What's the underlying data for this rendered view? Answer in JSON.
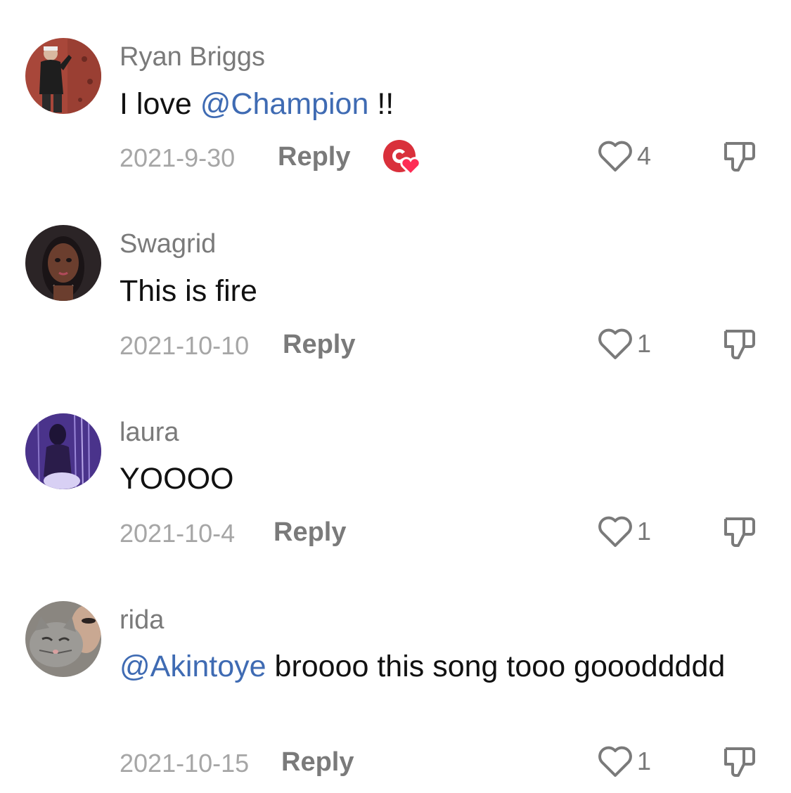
{
  "comments": [
    {
      "username": "Ryan Briggs",
      "text_before": "I love ",
      "mention": "@Champion",
      "text_after": " !!",
      "date": "2021-9-30",
      "reply_label": "Reply",
      "likes": "4",
      "creator_liked": true,
      "avatar_icon": "person-climbing-wall"
    },
    {
      "username": "Swagrid",
      "text": "This is fire",
      "date": "2021-10-10",
      "reply_label": "Reply",
      "likes": "1",
      "avatar_icon": "cartoon-princess"
    },
    {
      "username": "laura",
      "text": "YOOOO",
      "date": "2021-10-4",
      "reply_label": "Reply",
      "likes": "1",
      "avatar_icon": "purple-lit-portrait"
    },
    {
      "username": "rida",
      "mention": "@Akintoye",
      "text_after": " broooo this song tooo goooddddd",
      "date": "2021-10-15",
      "reply_label": "Reply",
      "likes": "1",
      "avatar_icon": "gray-cat"
    }
  ],
  "colors": {
    "mention": "#3f6bb3",
    "username": "#7a7a7a",
    "date": "#a6a6a6",
    "creator_badge": "#d9303b"
  }
}
